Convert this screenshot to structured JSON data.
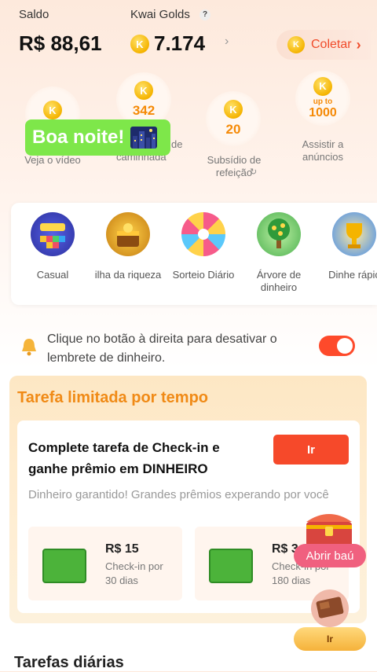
{
  "header": {
    "balance_label": "Saldo",
    "balance_value": "R$ 88,61",
    "golds_label": "Kwai Golds",
    "help_icon_text": "?",
    "golds_value": "7.174",
    "collect_label": "Coletar",
    "coin_letter": "K"
  },
  "tasks": [
    {
      "label": "Veja o vídeo"
    },
    {
      "coin_value": "342",
      "label": "de caminhada"
    },
    {
      "coin_value": "20",
      "label": "Subsídio de refeição"
    },
    {
      "coin_value_small": "up to",
      "coin_value": "1000",
      "label": "Assistir a anúncios"
    }
  ],
  "greeting": {
    "text": "Boa noite!"
  },
  "games": [
    {
      "label": "Casual",
      "icon": "blocks-puzzle-icon",
      "color": "#3b3fbf"
    },
    {
      "label": "ilha da riqueza",
      "icon": "treasure-island-icon",
      "color": "#e7a821"
    },
    {
      "label": "Sorteio Diário",
      "icon": "prize-wheel-icon",
      "color": "#f65b8a"
    },
    {
      "label": "Árvore de dinheiro",
      "icon": "money-tree-icon",
      "color": "#37a84a"
    },
    {
      "label": "Dinhe rápic",
      "icon": "trophy-icon",
      "color": "#f3a51c"
    }
  ],
  "reminder": {
    "text": "Clique no botão à direita para desativar o lembrete de dinheiro.",
    "toggle_on": true
  },
  "limited": {
    "title": "Tarefa limitada por tempo",
    "card_title": "Complete tarefa de Check-in e ganhe prêmio em DINHEIRO",
    "button": "Ir",
    "subtitle": "Dinheiro garantido! Grandes prêmios experando por você",
    "rewards": [
      {
        "amount": "R$ 15",
        "desc": "Check-in por 30 dias"
      },
      {
        "amount": "R$ 3",
        "desc": "Check-in por 180 dias"
      }
    ]
  },
  "floating": {
    "chest_label": "Abrir baú",
    "bottom_button": "Ir"
  },
  "daily": {
    "title": "Tarefas diárias"
  },
  "colors": {
    "accent": "#f6492a",
    "orange_title": "#f08a16",
    "green_badge": "#7ee74a"
  }
}
